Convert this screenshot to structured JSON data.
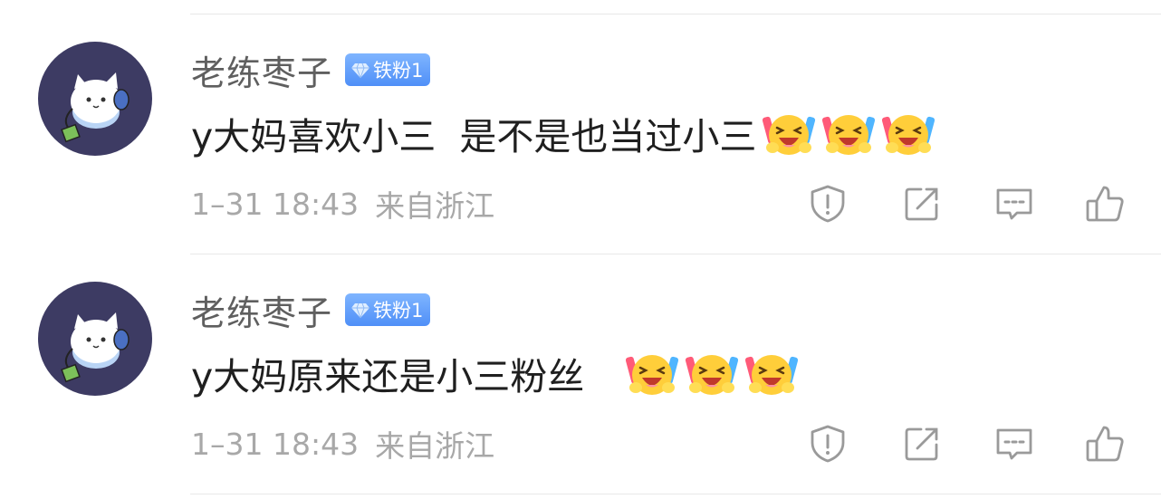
{
  "comments": [
    {
      "author": "老练枣子",
      "badge": "铁粉1",
      "text": "y大妈喜欢小三  是不是也当过小三",
      "emoji_count": 3,
      "time": "1–31 18:43",
      "location": "来自浙江"
    },
    {
      "author": "老练枣子",
      "badge": "铁粉1",
      "text": "y大妈原来还是小三粉丝   ",
      "emoji_count": 3,
      "time": "1–31 18:43",
      "location": "来自浙江"
    }
  ],
  "icons": {
    "avatar": "white-cat-avatar-icon",
    "badge": "diamond-icon",
    "emoji": "laughing-cheer-emoji-icon",
    "actions": [
      "report-icon",
      "repost-icon",
      "reply-icon",
      "like-icon"
    ]
  },
  "colors": {
    "avatar_bg": "#3d3b63",
    "badge_bg": "#5d9af9",
    "meta_text": "#a8a8a8"
  }
}
